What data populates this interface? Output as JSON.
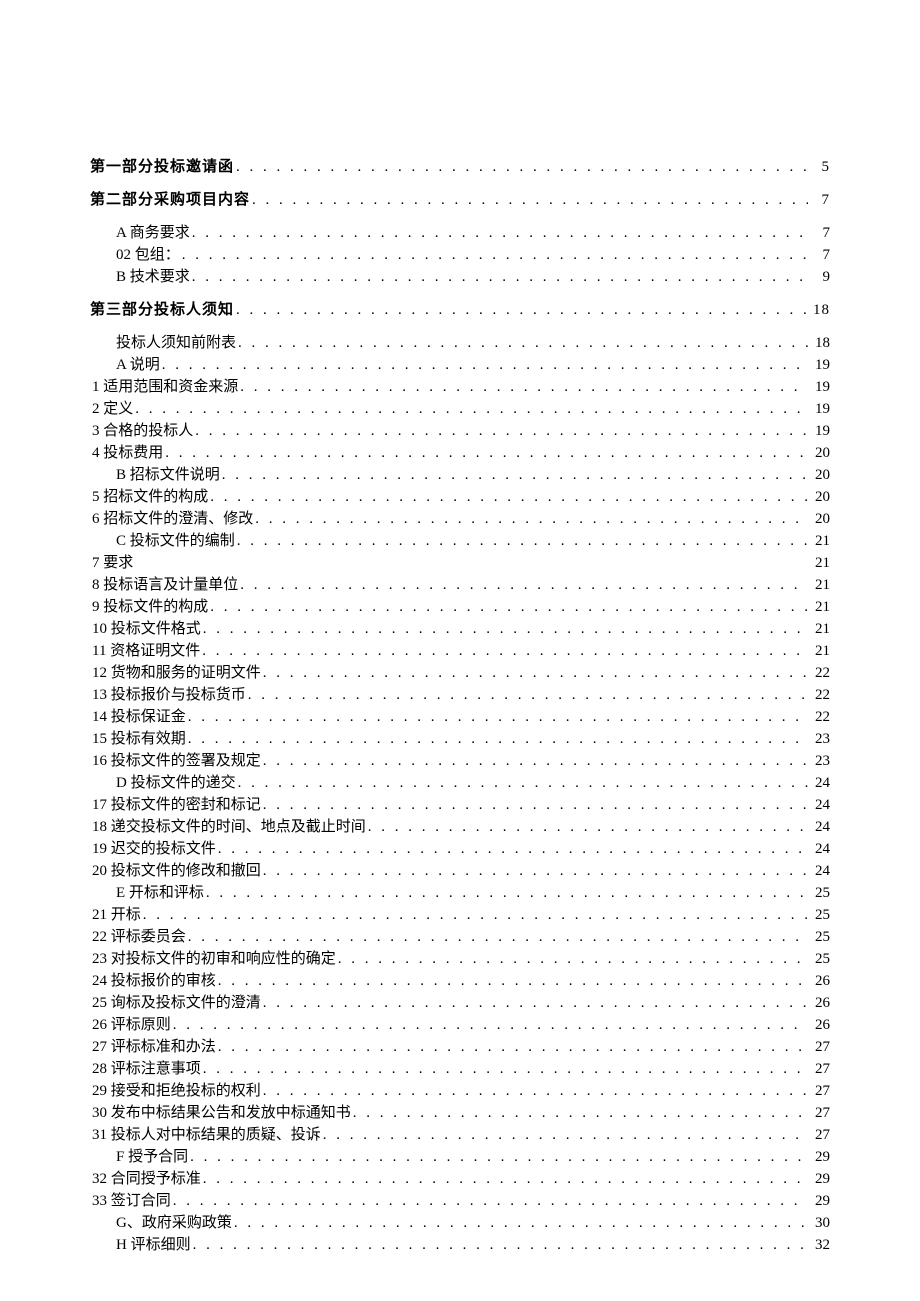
{
  "toc": [
    {
      "level": 0,
      "label": "第一部分投标邀请函",
      "page": "5",
      "dots": true
    },
    {
      "level": 0,
      "label": "第二部分采购项目内容",
      "page": "7",
      "dots": true
    },
    {
      "level": 2,
      "label": "A 商务要求",
      "page": "7",
      "dots": true
    },
    {
      "level": 2,
      "label": "02 包组：",
      "page": "7",
      "dots": true
    },
    {
      "level": 2,
      "label": "B 技术要求",
      "page": "9",
      "dots": true
    },
    {
      "level": 0,
      "label": "第三部分投标人须知",
      "page": "18",
      "dots": true
    },
    {
      "level": 2,
      "label": "投标人须知前附表",
      "page": "18",
      "dots": true
    },
    {
      "level": 2,
      "label": "A 说明",
      "page": "19",
      "dots": true
    },
    {
      "level": 1,
      "label": "1 适用范围和资金来源",
      "page": "19",
      "dots": true
    },
    {
      "level": 1,
      "label": "2 定义",
      "page": "19",
      "dots": true
    },
    {
      "level": 1,
      "label": "3 合格的投标人",
      "page": "19",
      "dots": true
    },
    {
      "level": 1,
      "label": "4 投标费用",
      "page": "20",
      "dots": true
    },
    {
      "level": 2,
      "label": "B 招标文件说明",
      "page": "20",
      "dots": true
    },
    {
      "level": 1,
      "label": "5 招标文件的构成",
      "page": "20",
      "dots": true
    },
    {
      "level": 1,
      "label": "6 招标文件的澄清、修改",
      "page": "20",
      "dots": true
    },
    {
      "level": 2,
      "label": "C 投标文件的编制",
      "page": "21",
      "dots": true
    },
    {
      "level": 1,
      "label": "7 要求",
      "page": "21",
      "dots": false
    },
    {
      "level": 1,
      "label": "8 投标语言及计量单位",
      "page": "21",
      "dots": true
    },
    {
      "level": 1,
      "label": "9 投标文件的构成",
      "page": "21",
      "dots": true
    },
    {
      "level": 1,
      "label": "10 投标文件格式",
      "page": "21",
      "dots": true
    },
    {
      "level": 1,
      "label": "11 资格证明文件",
      "page": "21",
      "dots": true
    },
    {
      "level": 1,
      "label": "12 货物和服务的证明文件",
      "page": "22",
      "dots": true
    },
    {
      "level": 1,
      "label": "13 投标报价与投标货币",
      "page": "22",
      "dots": true
    },
    {
      "level": 1,
      "label": "14 投标保证金",
      "page": "22",
      "dots": true
    },
    {
      "level": 1,
      "label": "15 投标有效期",
      "page": "23",
      "dots": true
    },
    {
      "level": 1,
      "label": "16 投标文件的签署及规定",
      "page": "23",
      "dots": true
    },
    {
      "level": 2,
      "label": "D 投标文件的递交",
      "page": "24",
      "dots": true
    },
    {
      "level": 1,
      "label": "17 投标文件的密封和标记",
      "page": "24",
      "dots": true
    },
    {
      "level": 1,
      "label": "18 递交投标文件的时间、地点及截止时间",
      "page": "24",
      "dots": true
    },
    {
      "level": 1,
      "label": "19 迟交的投标文件",
      "page": "24",
      "dots": true
    },
    {
      "level": 1,
      "label": "20 投标文件的修改和撤回",
      "page": "24",
      "dots": true
    },
    {
      "level": 2,
      "label": "E 开标和评标",
      "page": "25",
      "dots": true
    },
    {
      "level": 1,
      "label": "21 开标",
      "page": "25",
      "dots": true
    },
    {
      "level": 1,
      "label": "22 评标委员会",
      "page": "25",
      "dots": true
    },
    {
      "level": 1,
      "label": "23 对投标文件的初审和响应性的确定",
      "page": "25",
      "dots": true
    },
    {
      "level": 1,
      "label": "24 投标报价的审核",
      "page": "26",
      "dots": true
    },
    {
      "level": 1,
      "label": "25 询标及投标文件的澄清",
      "page": "26",
      "dots": true
    },
    {
      "level": 1,
      "label": "26 评标原则",
      "page": "26",
      "dots": true
    },
    {
      "level": 1,
      "label": "27 评标标准和办法",
      "page": "27",
      "dots": true
    },
    {
      "level": 1,
      "label": "28 评标注意事项",
      "page": "27",
      "dots": true
    },
    {
      "level": 1,
      "label": "29 接受和拒绝投标的权利",
      "page": "27",
      "dots": true
    },
    {
      "level": 1,
      "label": "30 发布中标结果公告和发放中标通知书",
      "page": "27",
      "dots": true
    },
    {
      "level": 1,
      "label": "31 投标人对中标结果的质疑、投诉",
      "page": "27",
      "dots": true
    },
    {
      "level": 2,
      "label": "F 授予合同",
      "page": "29",
      "dots": true
    },
    {
      "level": 1,
      "label": "32 合同授予标准",
      "page": "29",
      "dots": true
    },
    {
      "level": 1,
      "label": "33 签订合同",
      "page": "29",
      "dots": true
    },
    {
      "level": 2,
      "label": "G、政府采购政策",
      "page": "30",
      "dots": true
    },
    {
      "level": 2,
      "label": "H 评标细则",
      "page": "32",
      "dots": true
    }
  ]
}
